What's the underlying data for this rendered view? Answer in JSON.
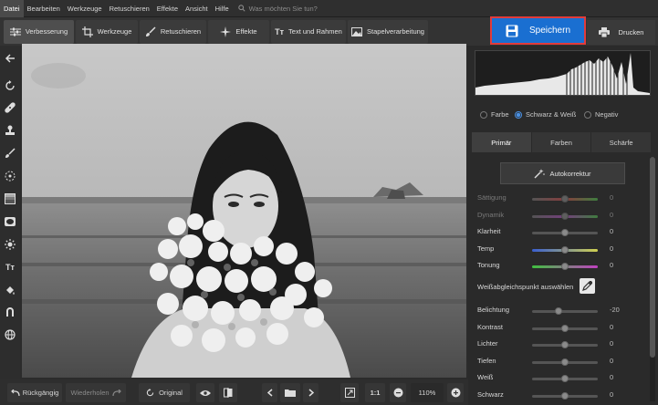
{
  "menu": {
    "items": [
      "Datei",
      "Bearbeiten",
      "Werkzeuge",
      "Retuschieren",
      "Effekte",
      "Ansicht",
      "Hilfe"
    ],
    "search_placeholder": "Was möchten Sie tun?"
  },
  "toolbar": {
    "tabs": [
      "Verbesserung",
      "Werkzeuge",
      "Retuschieren",
      "Effekte",
      "Text und Rahmen",
      "Stapelverarbeitung"
    ],
    "active_tab": "Verbesserung",
    "save_label": "Speichern",
    "print_label": "Drucken"
  },
  "sidebar": {
    "icons": [
      "back-arrow-icon",
      "rotate-icon",
      "healing-icon",
      "stamp-icon",
      "brush-icon",
      "target-icon",
      "gradient-icon",
      "vignette-icon",
      "sun-icon",
      "text-icon",
      "fill-icon",
      "magnet-icon",
      "globe-icon"
    ]
  },
  "bottom": {
    "undo_label": "Rückgängig",
    "redo_label": "Wiederholen",
    "original_label": "Original",
    "ratio_label": "1:1",
    "zoom_label": "110%"
  },
  "panel": {
    "color_modes": [
      "Farbe",
      "Schwarz & Weiß",
      "Negativ"
    ],
    "selected_mode": "Schwarz & Weiß",
    "tabs": [
      "Primär",
      "Farben",
      "Schärfe"
    ],
    "active_tab": "Primär",
    "auto_label": "Autokorrektur",
    "wb_label": "Weißabgleichspunkt auswählen",
    "sliders_top": [
      {
        "label": "Sättigung",
        "value": "0",
        "disabled": true,
        "pos": 0.5
      },
      {
        "label": "Dynamik",
        "value": "0",
        "disabled": true,
        "pos": 0.5
      },
      {
        "label": "Klarheit",
        "value": "0",
        "disabled": false,
        "pos": 0.5
      },
      {
        "label": "Temp",
        "value": "0",
        "disabled": false,
        "pos": 0.5
      },
      {
        "label": "Tonung",
        "value": "0",
        "disabled": false,
        "pos": 0.5
      }
    ],
    "sliders_bottom": [
      {
        "label": "Belichtung",
        "value": "-20",
        "disabled": false,
        "pos": 0.4
      },
      {
        "label": "Kontrast",
        "value": "0",
        "disabled": false,
        "pos": 0.5
      },
      {
        "label": "Lichter",
        "value": "0",
        "disabled": false,
        "pos": 0.5
      },
      {
        "label": "Tiefen",
        "value": "0",
        "disabled": false,
        "pos": 0.5
      },
      {
        "label": "Weiß",
        "value": "0",
        "disabled": false,
        "pos": 0.5
      },
      {
        "label": "Schwarz",
        "value": "0",
        "disabled": false,
        "pos": 0.5
      }
    ]
  },
  "colors": {
    "accent": "#1a6fd1",
    "highlight_border": "#e23b3b",
    "background": "#2b2b2b"
  }
}
